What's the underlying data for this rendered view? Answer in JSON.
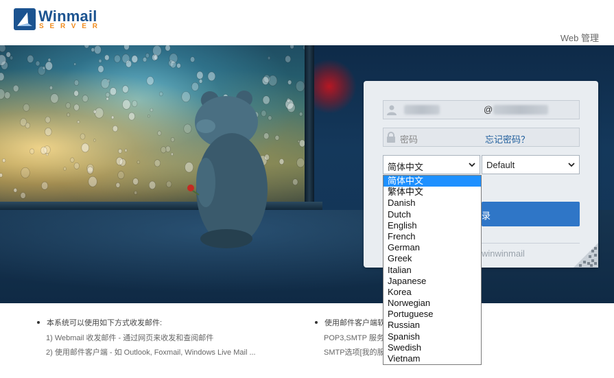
{
  "header": {
    "logo_name": "Winmail",
    "logo_sub": "SERVER",
    "web_admin": "Web 管理"
  },
  "login": {
    "at_sign": "@",
    "password_placeholder": "密码",
    "forgot_password": "忘记密码？",
    "language_selected": "简体中文",
    "style_selected": "Default",
    "login_button": "录",
    "brand_tag": "winwinmail"
  },
  "language_options": [
    "简体中文",
    "繁体中文",
    "Danish",
    "Dutch",
    "English",
    "French",
    "German",
    "Greek",
    "Italian",
    "Japanese",
    "Korea",
    "Norwegian",
    "Portuguese",
    "Russian",
    "Spanish",
    "Swedish",
    "Vietnam"
  ],
  "footer": {
    "col1_title": "本系统可以使用如下方式收发邮件:",
    "col1_line1": "1) Webmail 收发邮件 - 通过网页来收发和查阅邮件",
    "col1_line2": "2) 使用邮件客户端 - 如 Outlook, Foxmail, Windows Live Mail ...",
    "col2_title": "使用邮件客户端软",
    "col2_line1": "POP3,SMTP 服务",
    "col2_line2": "SMTP选项[我的服"
  },
  "colors": {
    "brand_blue": "#1b5390",
    "brand_orange": "#f18c1e",
    "button_blue": "#2f76c7",
    "selected_option": "#1e90ff"
  }
}
